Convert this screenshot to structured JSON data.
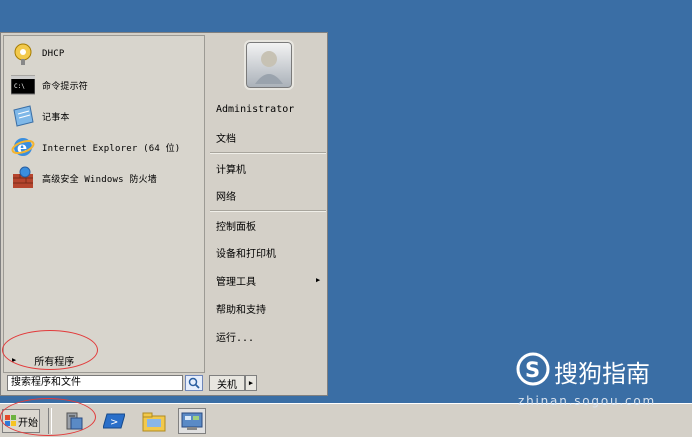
{
  "start_menu": {
    "programs": [
      {
        "label": "DHCP",
        "icon": "dhcp-icon"
      },
      {
        "label": "命令提示符",
        "icon": "cmd-icon"
      },
      {
        "label": "记事本",
        "icon": "notepad-icon"
      },
      {
        "label": "Internet Explorer (64 位)",
        "icon": "ie-icon"
      },
      {
        "label": "高级安全 Windows 防火墙",
        "icon": "firewall-icon"
      }
    ],
    "all_programs": "所有程序",
    "search": {
      "placeholder": "搜索程序和文件"
    },
    "right": {
      "user": "Administrator",
      "items": [
        "文档",
        "计算机",
        "网络",
        "控制面板",
        "设备和打印机",
        "管理工具",
        "帮助和支持",
        "运行..."
      ]
    },
    "shutdown": "关机"
  },
  "taskbar": {
    "start_label": "开始",
    "icons": [
      "server-manager-icon",
      "powershell-icon",
      "explorer-folder-icon",
      "control-panel-icon"
    ]
  },
  "watermark": {
    "text": "搜狗指南",
    "url": "zhinan.sogou.com"
  },
  "colors": {
    "desktop": "#3a6ea5",
    "menu": "#d4d0c8",
    "annotation": "#e23b3b"
  }
}
